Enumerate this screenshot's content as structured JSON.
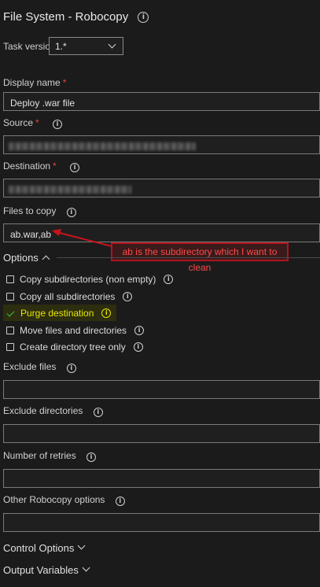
{
  "header": {
    "title": "File System - Robocopy"
  },
  "task_version": {
    "label": "Task version",
    "value": "1.*"
  },
  "display_name": {
    "label": "Display name",
    "required_mark": "*",
    "value": "Deploy .war file"
  },
  "source": {
    "label": "Source",
    "required_mark": "*"
  },
  "destination": {
    "label": "Destination",
    "required_mark": "*"
  },
  "files_to_copy": {
    "label": "Files to copy",
    "value": "ab.war,ab"
  },
  "annotation": {
    "text": "ab is the subdirectory which I want to clean"
  },
  "options": {
    "label": "Options",
    "items": [
      {
        "label": "Copy subdirectories (non empty)",
        "checked": false
      },
      {
        "label": "Copy all subdirectories",
        "checked": false
      },
      {
        "label": "Purge destination",
        "checked": true
      },
      {
        "label": "Move files and directories",
        "checked": false
      },
      {
        "label": "Create directory tree only",
        "checked": false
      }
    ]
  },
  "exclude_files": {
    "label": "Exclude files",
    "value": ""
  },
  "exclude_directories": {
    "label": "Exclude directories",
    "value": ""
  },
  "retries": {
    "label": "Number of retries",
    "value": ""
  },
  "other_options": {
    "label": "Other Robocopy options",
    "value": ""
  },
  "control_options": {
    "label": "Control Options"
  },
  "output_variables": {
    "label": "Output Variables"
  },
  "colors": {
    "required": "#e0453a",
    "annotation_border": "#b0141e",
    "annotation_text": "#ff4a4a",
    "highlight": "#e6e600",
    "check": "#3fbf3f"
  }
}
